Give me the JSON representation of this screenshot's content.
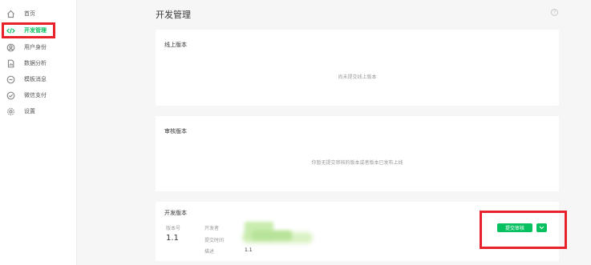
{
  "sidebar": {
    "items": [
      {
        "label": "首页",
        "icon": "home-icon"
      },
      {
        "label": "开发管理",
        "icon": "code-icon",
        "active": true
      },
      {
        "label": "用户身份",
        "icon": "user-circle-icon"
      },
      {
        "label": "数据分析",
        "icon": "document-chart-icon"
      },
      {
        "label": "模板消息",
        "icon": "message-icon"
      },
      {
        "label": "微信支付",
        "icon": "check-circle-icon"
      },
      {
        "label": "设置",
        "icon": "gear-icon"
      }
    ]
  },
  "header": {
    "title": "开发管理",
    "help": "?"
  },
  "online_card": {
    "title": "线上版本",
    "empty": "尚未提交线上版本"
  },
  "review_card": {
    "title": "审核版本",
    "empty": "你暂无提交审核的版本或者版本已发布上线"
  },
  "dev_card": {
    "title": "开发版本",
    "version_label": "版本号",
    "version_value": "1.1",
    "developer_label": "开发者",
    "submit_time_label": "提交时间",
    "desc_label": "描述",
    "desc_value": "1.1",
    "submit_button": "提交审核",
    "colors": {
      "accent": "#07c160",
      "highlight": "#e8222b"
    }
  }
}
